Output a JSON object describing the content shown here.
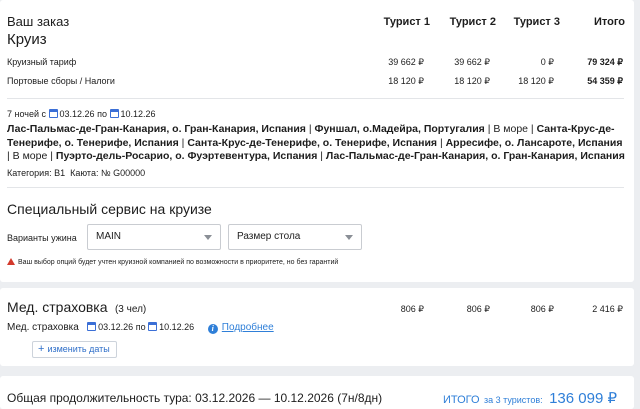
{
  "order": {
    "title": "Ваш заказ",
    "subtitle": "Круиз",
    "columns": [
      "Турист 1",
      "Турист 2",
      "Турист 3",
      "Итого"
    ],
    "rows": [
      {
        "label": "Круизный тариф",
        "values": [
          "39 662 ₽",
          "39 662 ₽",
          "0 ₽",
          "79 324 ₽"
        ]
      },
      {
        "label": "Портовые сборы / Налоги",
        "values": [
          "18 120 ₽",
          "18 120 ₽",
          "18 120 ₽",
          "54 359 ₽"
        ]
      }
    ],
    "nights": "7 ночей с",
    "date_from": "03.12.26",
    "date_to_prefix": "по",
    "date_to": "10.12.26",
    "route": [
      "Лас-Пальмас-де-Гран-Канария, о. Гран-Канария, Испания",
      "Фуншал, о.Мадейра, Португалия",
      "В море",
      "Санта-Крус-де-Тенерифе, о. Тенерифе, Испания",
      "Санта-Крус-де-Тенерифе, о. Тенерифе, Испания",
      "Арресифе, о. Лансароте, Испания",
      "В море",
      "Пуэрто-дель-Росарио, о. Фуэртевентура, Испания",
      "Лас-Пальмас-де-Гран-Канария, о. Гран-Канария, Испания"
    ],
    "category_label": "Категория:",
    "category_value": "B1",
    "cabin_label": "Каюта:",
    "cabin_value": "№ G00000"
  },
  "service": {
    "title": "Специальный сервис на круизе",
    "dinner_label": "Варианты ужина",
    "dinner_value": "MAIN",
    "table_size_placeholder": "Размер стола",
    "warning": "Ваш выбор опций будет учтен круизной компанией по возможности в приоритете, но без гарантий"
  },
  "insurance": {
    "title": "Мед. страховка",
    "count": "(3 чел)",
    "values": [
      "806 ₽",
      "806 ₽",
      "806 ₽",
      "2 416 ₽"
    ],
    "row_label": "Мед. страховка",
    "date_from": "03.12.26",
    "date_to_prefix": "по",
    "date_to": "10.12.26",
    "details_link": "Подробнее",
    "change_dates_button": "изменить даты"
  },
  "footer": {
    "duration": "Общая продолжительность тура: 03.12.2026 — 10.12.2026 (7н/8дн)",
    "total_label": "ИТОГО",
    "total_for": "за 3 туристов:",
    "total_value": "136 099 ₽"
  },
  "colors": {
    "accent": "#2f7fd8",
    "warning": "#d33a2c",
    "background": "#eceef1"
  }
}
